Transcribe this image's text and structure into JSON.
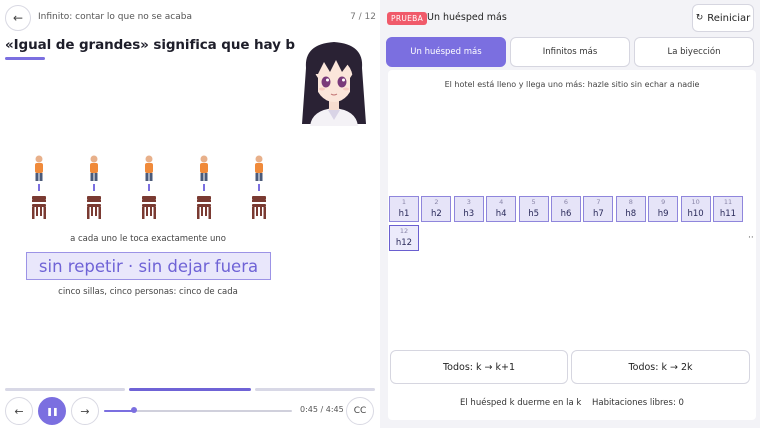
{
  "header": {
    "lesson_title": "Infinito: contar lo que no se acaba",
    "page_count": "7 / 12",
    "back_icon": "←"
  },
  "slide": {
    "heading": "«Igual de grandes» significa que hay biyección",
    "caption_top": "a cada uno le toca exactamente uno",
    "caption_main": "sin repetir · sin dejar fuera",
    "caption_bottom": "cinco sillas, cinco personas: cinco de cada",
    "person_count": 5,
    "colors": {
      "person_body": "#f08a3a",
      "person_legs": "#4a5a7a",
      "link": "#7b6fe0",
      "chair": "#7a3a32"
    }
  },
  "player": {
    "prev_icon": "←",
    "pause_icon": "❚❚",
    "next_icon": "→",
    "time": "0:45 / 4:45",
    "progress": 0.16,
    "cc_label": "CC"
  },
  "sim": {
    "badge": "PRUEBA",
    "title": "Un huésped más",
    "reset_label": "Reiniciar",
    "reset_icon": "↻",
    "tabs": [
      {
        "label": "Un huésped más",
        "active": true
      },
      {
        "label": "Infinitos más",
        "active": false
      },
      {
        "label": "La biyección",
        "active": false
      }
    ],
    "instruction": "El hotel está lleno y llega uno más: hazle sitio sin echar a nadie",
    "rooms": [
      {
        "num": "1",
        "guest": "h1"
      },
      {
        "num": "2",
        "guest": "h2"
      },
      {
        "num": "3",
        "guest": "h3"
      },
      {
        "num": "4",
        "guest": "h4"
      },
      {
        "num": "5",
        "guest": "h5"
      },
      {
        "num": "6",
        "guest": "h6"
      },
      {
        "num": "7",
        "guest": "h7"
      },
      {
        "num": "8",
        "guest": "h8"
      },
      {
        "num": "9",
        "guest": "h9"
      },
      {
        "num": "10",
        "guest": "h10"
      },
      {
        "num": "11",
        "guest": "h11"
      },
      {
        "num": "12",
        "guest": "h12"
      }
    ],
    "ellipsis": "··",
    "actions": [
      {
        "label": "Todos: k → k+1"
      },
      {
        "label": "Todos: k → 2k"
      }
    ],
    "status_left": "El huésped k duerme en la k",
    "status_right": "Habitaciones libres: 0"
  }
}
